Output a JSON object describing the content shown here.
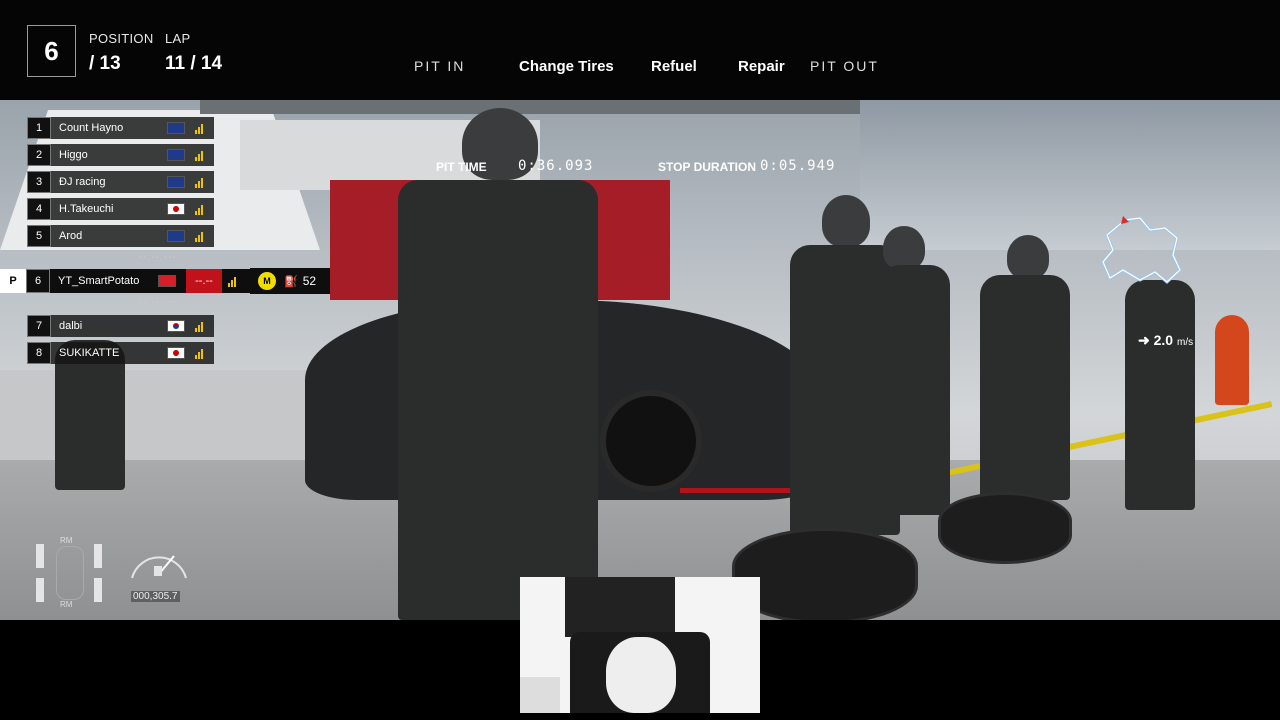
{
  "hud": {
    "position_value": "6",
    "position_label": "POSITION",
    "position_total": "/ 13",
    "lap_label": "LAP",
    "lap_value": "11 / 14"
  },
  "pit_menu": {
    "pit_in": "PIT IN",
    "change_tires": "Change Tires",
    "refuel": "Refuel",
    "repair": "Repair",
    "pit_out": "PIT OUT"
  },
  "pit_timer": {
    "pit_time_label": "PIT TIME",
    "pit_time_value": "0:36.093",
    "stop_duration_label": "STOP DURATION",
    "stop_duration_value": "0:05.949"
  },
  "leaderboard": {
    "rows": [
      {
        "pos": "1",
        "name": "Count Hayno",
        "flag": "AU"
      },
      {
        "pos": "2",
        "name": "Higgo",
        "flag": "AU"
      },
      {
        "pos": "3",
        "name": "ÐJ racing",
        "flag": "AU"
      },
      {
        "pos": "4",
        "name": "H.Takeuchi",
        "flag": "JP"
      },
      {
        "pos": "5",
        "name": "Arod",
        "flag": "AU"
      }
    ],
    "separator": "--:--.---",
    "player": {
      "marker": "P",
      "pos": "6",
      "name": "YT_SmartPotato",
      "flag": "HK",
      "gap": "--.--",
      "badge": "M",
      "fuel": "52"
    },
    "rows_after": [
      {
        "pos": "7",
        "name": "dalbi",
        "flag": "KR"
      },
      {
        "pos": "8",
        "name": "SUKIKATTE",
        "flag": "JP"
      }
    ]
  },
  "speed": {
    "value": "2.0",
    "unit": "m/s"
  },
  "car_status": {
    "front_label": "RM",
    "rear_label": "RM",
    "fuel_readout": "000,305.7"
  },
  "colors": {
    "accent_yellow": "#f2dd00",
    "gap_red": "#c1121b",
    "map_track": "#9fc6e8"
  }
}
